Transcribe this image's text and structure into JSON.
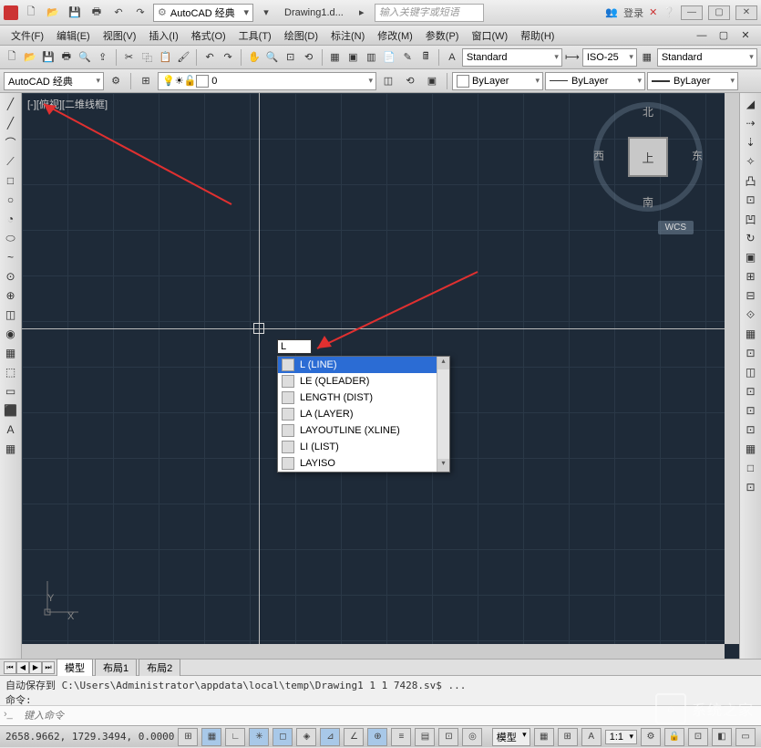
{
  "title": {
    "workspace": "AutoCAD 经典",
    "document": "Drawing1.d...",
    "search_placeholder": "输入关键字或短语",
    "login_text": "登录"
  },
  "menubar": [
    "文件(F)",
    "编辑(E)",
    "视图(V)",
    "插入(I)",
    "格式(O)",
    "工具(T)",
    "绘图(D)",
    "标注(N)",
    "修改(M)",
    "参数(P)",
    "窗口(W)",
    "帮助(H)"
  ],
  "toolbar1_dd": {
    "style1": "Standard",
    "style2": "ISO-25",
    "style3": "Standard"
  },
  "toolbar2": {
    "workspace": "AutoCAD 经典",
    "layer_state": "0",
    "bylayer1": "ByLayer",
    "bylayer2": "ByLayer",
    "bylayer3": "ByLayer"
  },
  "left_tools": [
    "╱",
    "╱",
    "⌒",
    "⟋",
    "□",
    "○",
    "◔",
    "⬭",
    "~",
    "⊙",
    "⊕",
    "◫",
    "◉",
    "▦",
    "⬚",
    "▭",
    "⬛",
    "A",
    "▦"
  ],
  "right_tools": [
    "◢",
    "⇢",
    "⇣",
    "✧",
    "凸",
    "⊡",
    "凹",
    "↻",
    "▣",
    "⊞",
    "⊟",
    "⟐",
    "▦",
    "⊡",
    "◫",
    "⊡",
    "⊡",
    "⊡",
    "▦",
    "□",
    "⊡"
  ],
  "canvas": {
    "view_label": "[-][俯视][二维线框]",
    "viewcube": {
      "face": "上",
      "n": "北",
      "s": "南",
      "w": "西",
      "e": "东"
    },
    "wcs": "WCS",
    "ucs": {
      "x": "X",
      "y": "Y"
    },
    "dyn_input_value": "L",
    "autocomplete": [
      {
        "label": "L (LINE)",
        "sel": true
      },
      {
        "label": "LE (QLEADER)",
        "sel": false
      },
      {
        "label": "LENGTH (DIST)",
        "sel": false
      },
      {
        "label": "LA (LAYER)",
        "sel": false
      },
      {
        "label": "LAYOUTLINE (XLINE)",
        "sel": false
      },
      {
        "label": "LI (LIST)",
        "sel": false
      },
      {
        "label": "LAYISO",
        "sel": false
      }
    ]
  },
  "tabs": {
    "nav": [
      "⏮",
      "◀",
      "▶",
      "⏭"
    ],
    "model": "模型",
    "layout1": "布局1",
    "layout2": "布局2"
  },
  "cmd": {
    "history": "自动保存到 C:\\Users\\Administrator\\appdata\\local\\temp\\Drawing1_1_1_7428.sv$ ...",
    "prompt": "命令:",
    "placeholder": "键入命令"
  },
  "status": {
    "coords": "2658.9662, 1729.3494, 0.0000",
    "model": "模型",
    "scale": "1:1"
  },
  "watermark": "系统之家"
}
